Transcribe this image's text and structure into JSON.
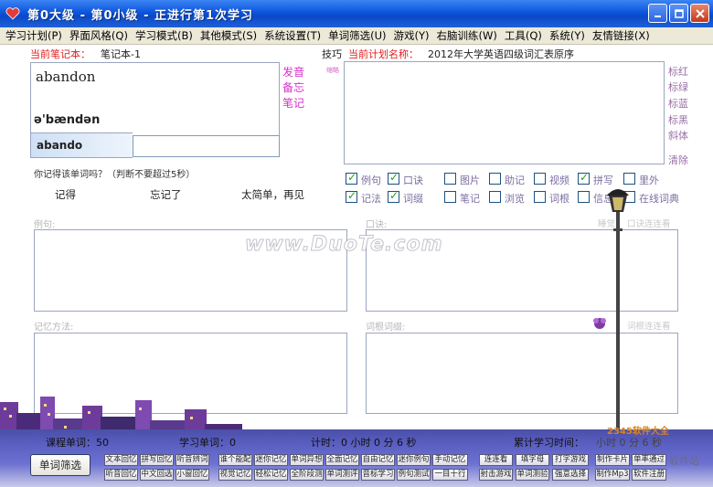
{
  "window": {
    "title": "第0大级 - 第0小级 - 正进行第1次学习"
  },
  "menu": [
    "学习计划(P)",
    "界面风格(Q)",
    "学习模式(B)",
    "其他模式(S)",
    "系统设置(T)",
    "单词筛选(U)",
    "游戏(Y)",
    "右脑训练(W)",
    "工具(Q)",
    "系统(Y)",
    "友情链接(X)"
  ],
  "notebook": {
    "label": "当前笔记本：",
    "name": "笔记本-1"
  },
  "word": {
    "text": "abandon",
    "phonetic": "ə'bændən",
    "typed": "abando",
    "links": [
      "发音",
      "备忘",
      "笔记"
    ]
  },
  "prompt": {
    "question": "你记得该单词吗？（判断不要超过5秒）",
    "remember": "记得",
    "forgot": "忘记了",
    "too_easy": "太简单，再见"
  },
  "plan": {
    "tips": "技巧",
    "label": "当前计划名称：",
    "name": "2012年大学英语四级词汇表原序",
    "tiny_note": "缩略"
  },
  "color_tools": [
    "标红",
    "标绿",
    "标蓝",
    "标黑",
    "斜体",
    "清除"
  ],
  "checkboxes": [
    {
      "label": "例句",
      "checked": true
    },
    {
      "label": "口诀",
      "checked": true
    },
    {
      "label": "图片",
      "checked": false
    },
    {
      "label": "助记",
      "checked": false
    },
    {
      "label": "视频",
      "checked": false
    },
    {
      "label": "拼写",
      "checked": true
    },
    {
      "label": "里外",
      "checked": false
    },
    {
      "label": "记法",
      "checked": true
    },
    {
      "label": "词缀",
      "checked": true
    },
    {
      "label": "笔记",
      "checked": false
    },
    {
      "label": "浏览",
      "checked": false
    },
    {
      "label": "词根",
      "checked": false
    },
    {
      "label": "信息",
      "checked": false
    },
    {
      "label": "在线词典",
      "checked": false
    }
  ],
  "sections": {
    "example": "例句:",
    "mnemonic": "口诀:",
    "mnemonic_link_a": "睡觉",
    "mnemonic_link_b": "口诀连连看",
    "memory_method": "记忆方法:",
    "root_affix": "词根词缀:",
    "root_link": "词根连连看"
  },
  "stats": {
    "course_words": "课程单词：50",
    "learned": "学习单词：0",
    "timer": "计时：0 小时 0 分 6 秒",
    "cumulative": "累计学习时间：",
    "cumulative_value": "小时 0 分 6 秒"
  },
  "bottom": {
    "filter_button": "单词筛选",
    "tools_row1": [
      "文本回忆",
      "拼写回忆",
      "听音辨词",
      "谁个能配",
      "迷你记忆",
      "单词异想",
      "全面记忆",
      "自由记忆",
      "迷你例句",
      "手动记忆",
      "连连看",
      "填字母",
      "打字游戏",
      "制作卡片",
      "单率通过"
    ],
    "tools_row2": [
      "听音回忆",
      "中文回选",
      "小窗回忆",
      "视觉记忆",
      "轻松记忆",
      "全阶段测",
      "单词测评",
      "音标学习",
      "例句测试",
      "一目十行",
      "射击游戏",
      "单词测验",
      "强意选择",
      "制作Mp3",
      "软件注册"
    ]
  },
  "watermark": {
    "main": "www.DuoTe.com",
    "corner": "2345软件大全",
    "corner2": "软件站"
  }
}
